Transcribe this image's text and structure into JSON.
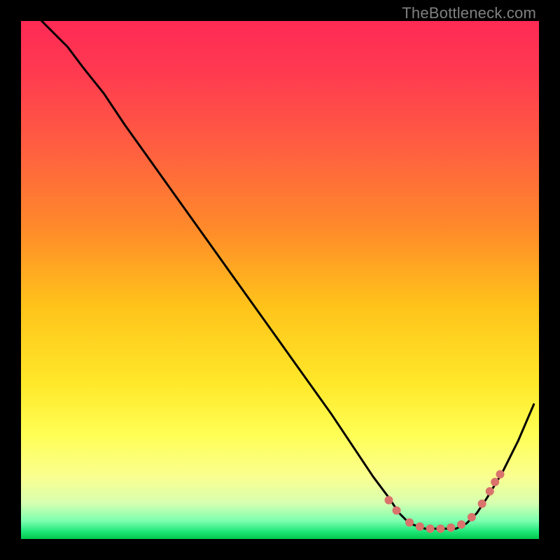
{
  "watermark": "TheBottleneck.com",
  "chart_data": {
    "type": "line",
    "title": "",
    "xlabel": "",
    "ylabel": "",
    "xlim": [
      0,
      100
    ],
    "ylim": [
      0,
      100
    ],
    "background_gradient_stops": [
      {
        "offset": 0.0,
        "color": "#ff2a55"
      },
      {
        "offset": 0.1,
        "color": "#ff3a50"
      },
      {
        "offset": 0.25,
        "color": "#ff6040"
      },
      {
        "offset": 0.4,
        "color": "#ff8a2a"
      },
      {
        "offset": 0.55,
        "color": "#ffc31a"
      },
      {
        "offset": 0.7,
        "color": "#ffe82a"
      },
      {
        "offset": 0.8,
        "color": "#ffff55"
      },
      {
        "offset": 0.88,
        "color": "#faff90"
      },
      {
        "offset": 0.93,
        "color": "#d8ffb0"
      },
      {
        "offset": 0.965,
        "color": "#7dffb0"
      },
      {
        "offset": 0.985,
        "color": "#20e87a"
      },
      {
        "offset": 1.0,
        "color": "#00c84c"
      }
    ],
    "series": [
      {
        "name": "bottleneck-curve",
        "color": "#000000",
        "x": [
          4,
          6,
          9,
          12,
          16,
          20,
          25,
          30,
          35,
          40,
          45,
          50,
          55,
          60,
          64,
          68,
          71,
          73,
          75,
          78,
          81,
          84,
          86,
          88,
          90,
          93,
          96,
          99
        ],
        "y": [
          100,
          98,
          95,
          91,
          86,
          80,
          73,
          66,
          59,
          52,
          45,
          38,
          31,
          24,
          18,
          12,
          8,
          5,
          3,
          2,
          2,
          2,
          3,
          5,
          8,
          13,
          19,
          26
        ]
      }
    ],
    "highlight_points": {
      "name": "optimal-zone-points",
      "color": "#d9736b",
      "radius": 6,
      "x": [
        71,
        72.5,
        75,
        77,
        79,
        81,
        83,
        85,
        87,
        89,
        90.5,
        91.5,
        92.5
      ],
      "y": [
        7.5,
        5.5,
        3.2,
        2.4,
        2.0,
        2.0,
        2.2,
        2.8,
        4.2,
        6.8,
        9.2,
        11.0,
        12.5
      ]
    }
  }
}
